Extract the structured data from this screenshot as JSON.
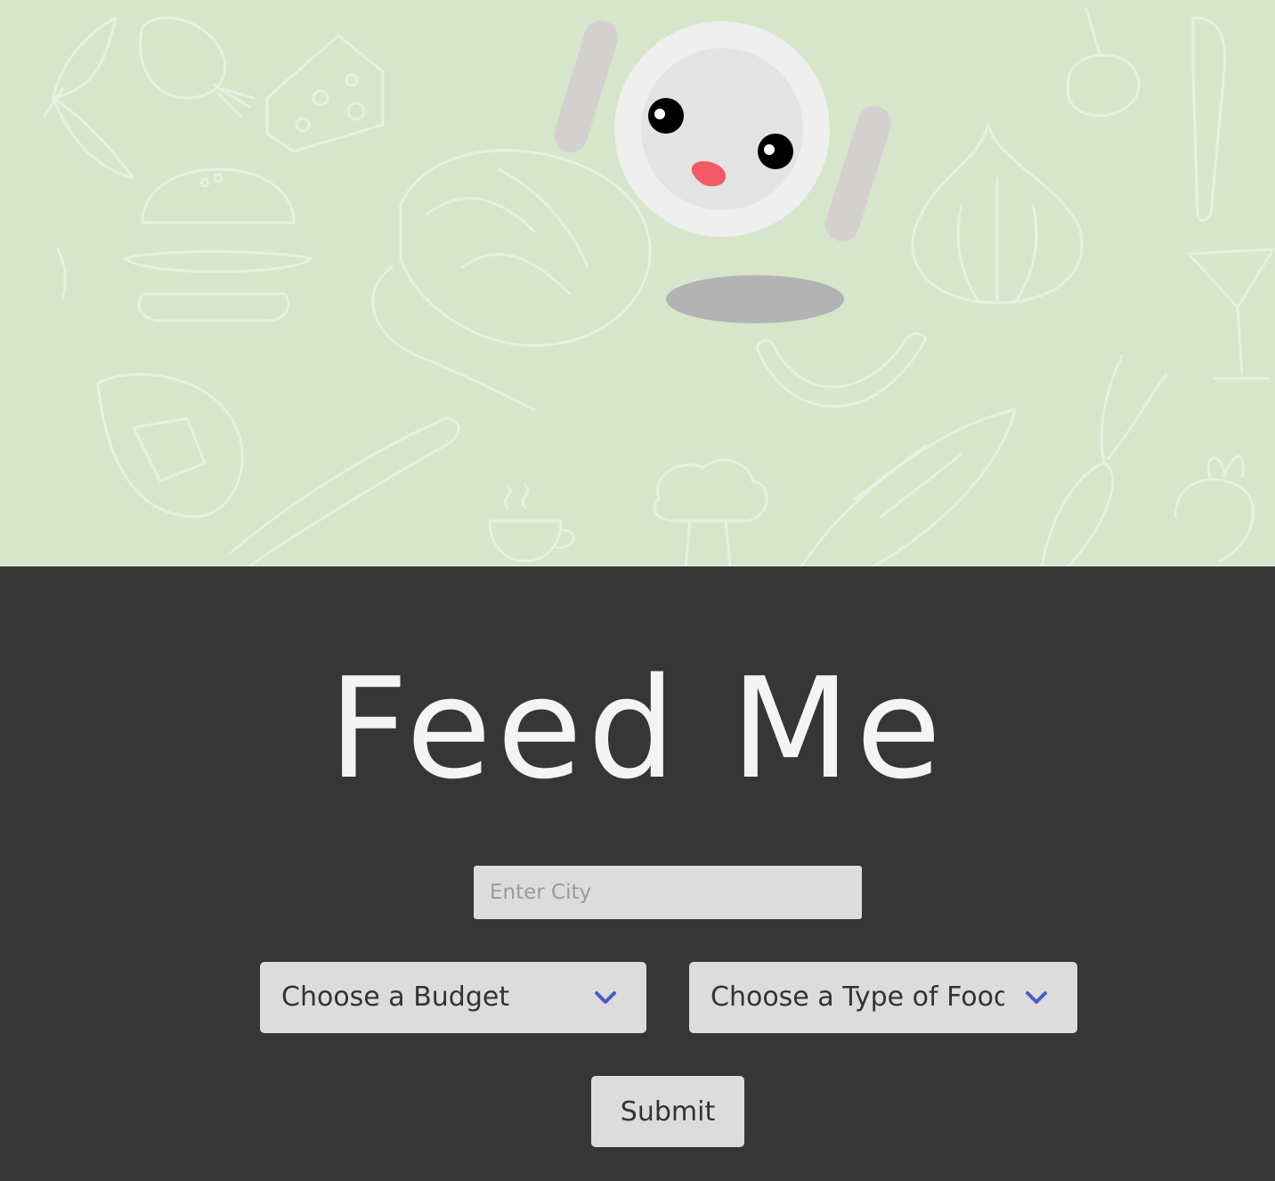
{
  "app": {
    "title": "Feed Me"
  },
  "form": {
    "city_placeholder": "Enter City",
    "city_value": "",
    "budget_selected": "Choose a Budget",
    "food_selected": "Choose a Type of Food",
    "submit_label": "Submit"
  },
  "icons": {
    "dropdown": "chevron-down-icon",
    "mascot": "plate-mascot-icon"
  },
  "colors": {
    "hero_background": "#d5e6cb",
    "panel_background": "#363636",
    "chevron": "#4a5bc4",
    "mascot_mouth": "#f25a66"
  }
}
